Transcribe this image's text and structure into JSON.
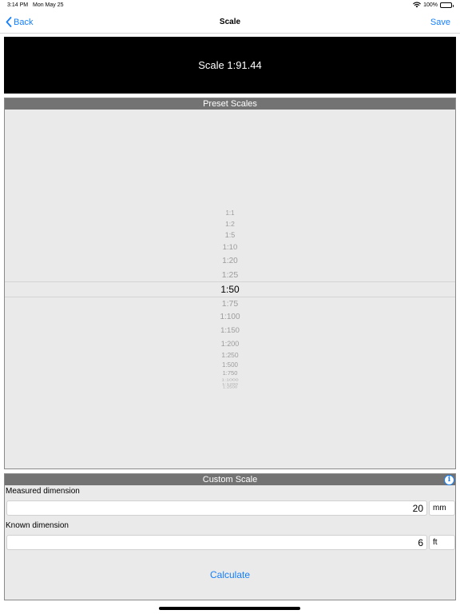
{
  "status_bar": {
    "time": "3:14 PM",
    "date": "Mon May 25",
    "battery": "100%"
  },
  "nav": {
    "back_label": "Back",
    "title": "Scale",
    "save_label": "Save"
  },
  "current_scale": "Scale 1:91.44",
  "preset_scales": {
    "header": "Preset Scales",
    "selected": "1:50",
    "items": [
      "1:1",
      "1:2",
      "1:5",
      "1:10",
      "1:20",
      "1:25",
      "1:50",
      "1:75",
      "1:100",
      "1:150",
      "1:200",
      "1:250",
      "1:500",
      "1:750",
      "1:1000",
      "1:1200",
      "1:2500"
    ]
  },
  "custom_scale": {
    "header": "Custom Scale",
    "measured": {
      "label": "Measured dimension",
      "value": "20",
      "unit": "mm"
    },
    "known": {
      "label": "Known dimension",
      "value": "6",
      "unit": "ft"
    },
    "calculate_label": "Calculate",
    "info_icon": "info-icon"
  }
}
